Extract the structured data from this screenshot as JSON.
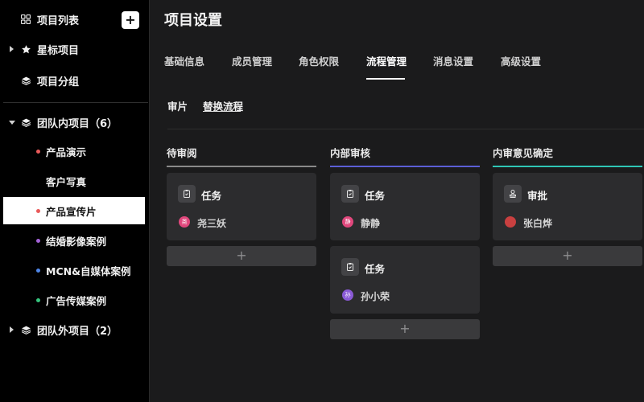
{
  "sidebar": {
    "project_list_label": "项目列表",
    "add_symbol": "+",
    "starred_label": "星标项目",
    "group_label": "项目分组",
    "team_inner_label": "团队内项目（6）",
    "team_outer_label": "团队外项目（2）",
    "inner_items": [
      {
        "label": "产品演示",
        "dot": "#e95a5a"
      },
      {
        "label": "客户写真",
        "dot": ""
      },
      {
        "label": "产品宣传片",
        "dot": "#e95a5a"
      },
      {
        "label": "结婚影像案例",
        "dot": "#a463d8"
      },
      {
        "label": "MCN&自媒体案例",
        "dot": "#4f86e8"
      },
      {
        "label": "广告传媒案例",
        "dot": "#36c57e"
      }
    ]
  },
  "main": {
    "title": "项目设置",
    "tabs": [
      "基础信息",
      "成员管理",
      "角色权限",
      "流程管理",
      "消息设置",
      "高级设置"
    ],
    "active_tab": 3,
    "subtabs": [
      "审片",
      "替换流程"
    ],
    "columns": [
      {
        "title": "待审阅",
        "accent": "#8a8a8a",
        "cards": [
          {
            "title": "任务",
            "icon": "clipboard-icon",
            "user": "尧三妖",
            "avatar_text": "尧",
            "avatar_color": "#e0477c"
          }
        ]
      },
      {
        "title": "内部审核",
        "accent": "#5b5fd6",
        "cards": [
          {
            "title": "任务",
            "icon": "clipboard-icon",
            "user": "静静",
            "avatar_text": "静",
            "avatar_color": "#e0477c"
          },
          {
            "title": "任务",
            "icon": "clipboard-icon",
            "user": "孙小荣",
            "avatar_text": "孙",
            "avatar_color": "#8a5ad6"
          }
        ]
      },
      {
        "title": "内审意见确定",
        "accent": "#2fc6b5",
        "cards": [
          {
            "title": "审批",
            "icon": "stamp-icon",
            "user": "张白烨",
            "avatar_text": "",
            "avatar_color": "#c94040"
          }
        ]
      }
    ],
    "add_card_symbol": "+"
  }
}
